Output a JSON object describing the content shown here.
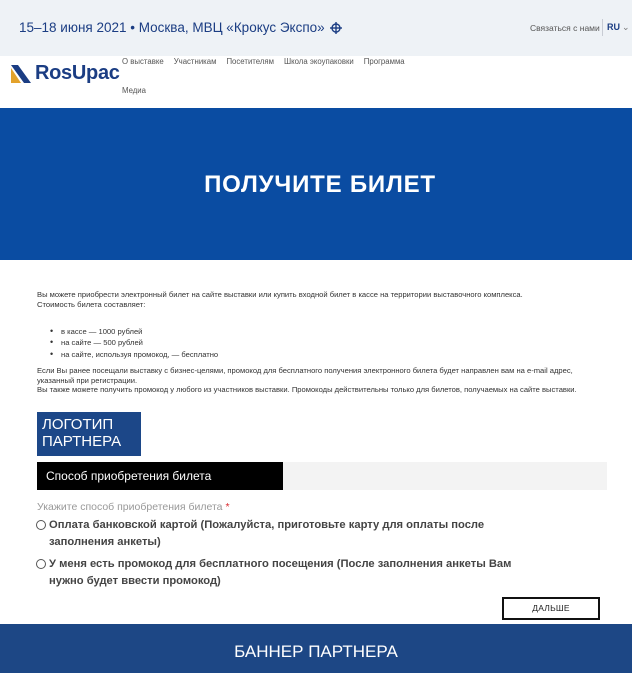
{
  "header": {
    "event_info": "15–18 июня 2021 • Москва, МВЦ «Крокус Экспо»",
    "location_icon": "target-icon",
    "contact_label": "Связаться с нами",
    "language": "RU",
    "language_chevron": "chevron-down-icon"
  },
  "logo": {
    "text": "RosUpac"
  },
  "nav": {
    "items": [
      "О выставке",
      "Участникам",
      "Посетителям",
      "Школа экоупаковки",
      "Программа",
      "Медиа"
    ]
  },
  "hero": {
    "title": "ПОЛУЧИТЕ БИЛЕТ"
  },
  "intro": {
    "text": "Вы можете приобрести электронный билет на сайте выставки или купить входной билет в кассе на территории выставочного комплекса.",
    "price_heading": "Стоимость билета составляет:",
    "prices": [
      "в кассе — 1000 рублей",
      "на сайте — 500 рублей",
      "на сайте, используя промокод, — бесплатно"
    ],
    "promo_text_1": "Если Вы ранее посещали выставку с бизнес-целями, промокод для бесплатного получения электронного билета будет направлен вам на e-mail адрес, указанный при регистрации.",
    "promo_text_2": "Вы также можете получить промокод у любого из участников выставки. Промокоды действительны только для билетов, получаемых на сайте выставки."
  },
  "partner_logo": {
    "line1": "ЛОГОТИП",
    "line2": "ПАРТНЕРА"
  },
  "form": {
    "section_title": "Способ приобретения билета",
    "question": "Укажите способ приобретения билета",
    "required_mark": "*",
    "options": [
      "Оплата банковской картой (Пожалуйста, приготовьте карту для оплаты после заполнения анкеты)",
      "У меня есть промокод для бесплатного посещения (После заполнения анкеты Вам нужно будет ввести промокод)"
    ],
    "next_label": "ДАЛЬШЕ"
  },
  "banner": {
    "text": "БАННЕР ПАРТНЕРА"
  },
  "colors": {
    "brand_blue": "#0a4ca2",
    "navy": "#1c4788",
    "required": "#d9262b"
  }
}
